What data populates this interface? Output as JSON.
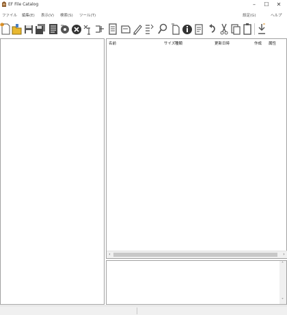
{
  "window": {
    "title": "EF File Catalog",
    "minimize": "–",
    "maximize": "☐",
    "close": "✕"
  },
  "menu": {
    "items": [
      "ファイル",
      "編集(E)",
      "表示(V)",
      "検索(S)",
      "ツール(T)"
    ],
    "right_items": [
      "設定(G)",
      "ヘルプ"
    ]
  },
  "toolbar": {
    "tools": [
      "new-catalog-icon",
      "open-folder-icon",
      "save-icon",
      "save-all-icon",
      "print-icon",
      "scan-disk-icon",
      "delete-icon",
      "rename-icon",
      "column-icon",
      "copy-icon",
      "export-icon",
      "edit-icon",
      "properties-icon",
      "search-icon",
      "new-file-icon",
      "info-icon",
      "bookmark-icon",
      "undo-icon",
      "cut-icon",
      "copy-clipboard-icon",
      "paste-icon",
      "import-icon"
    ],
    "colors": {
      "accent": "#d88a1a",
      "folder": "#e8b830",
      "icon": "#555555",
      "delete": "#444444"
    }
  },
  "file_list": {
    "columns": [
      "名前",
      "サイズ",
      "種類",
      "更新日時",
      "作成",
      "属性"
    ]
  },
  "colors": {
    "border": "#a0a0a0",
    "statusbar": "#f0f0f0"
  }
}
